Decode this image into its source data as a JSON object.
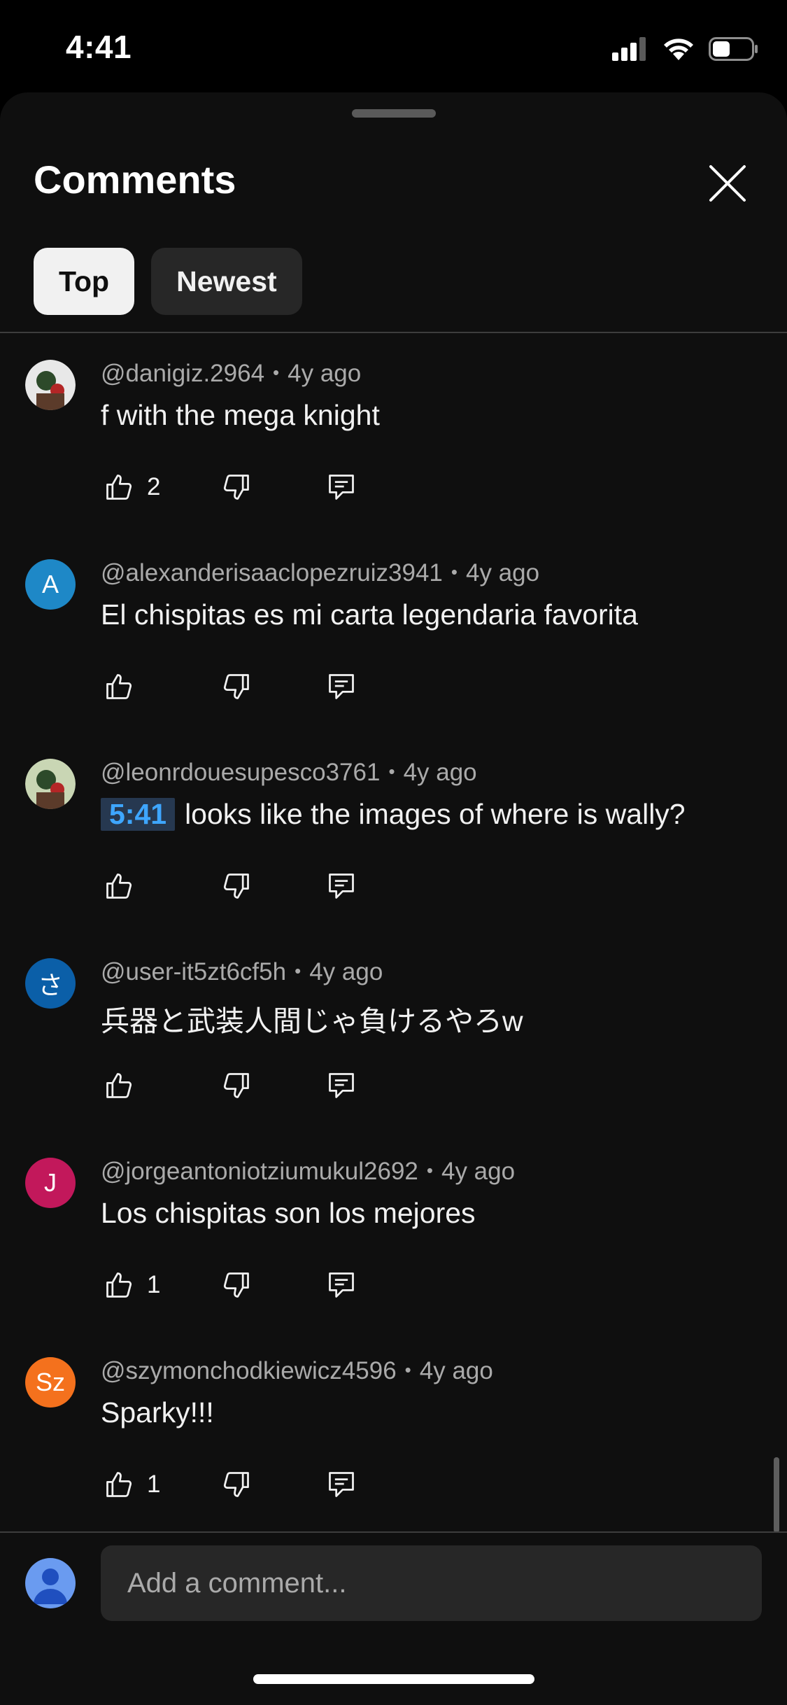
{
  "status_bar": {
    "time": "4:41",
    "icons": [
      "cellular-signal-icon",
      "wifi-icon",
      "battery-icon"
    ],
    "battery_level": 0.45
  },
  "sheet": {
    "title": "Comments",
    "close_icon": "close-icon",
    "filters": [
      {
        "label": "Top",
        "selected": true
      },
      {
        "label": "Newest",
        "selected": false
      }
    ]
  },
  "comments": [
    {
      "author": "@danigiz.2964",
      "age": "4y ago",
      "text": "f with the mega knight",
      "likes": "2",
      "avatar": {
        "kind": "image",
        "letter": "",
        "color": "#e8e8e8"
      }
    },
    {
      "author": "@alexanderisaaclopezruiz3941",
      "age": "4y ago",
      "text": "El chispitas es mi carta legendaria favorita",
      "likes": "",
      "avatar": {
        "kind": "letter",
        "letter": "A",
        "color": "#1e88c7"
      }
    },
    {
      "author": "@leonrdouesupesco3761",
      "age": "4y ago",
      "timestamp": "5:41",
      "text": "looks like the images of where is wally?",
      "likes": "",
      "avatar": {
        "kind": "image",
        "letter": "",
        "color": "#c9d6b4"
      }
    },
    {
      "author": "@user-it5zt6cf5h",
      "age": "4y ago",
      "text": "兵器と武装人間じゃ負けるやろw",
      "likes": "",
      "avatar": {
        "kind": "letter",
        "letter": "さ",
        "color": "#0b5fa8"
      }
    },
    {
      "author": "@jorgeantoniotziumukul2692",
      "age": "4y ago",
      "text": "Los chispitas son los mejores",
      "likes": "1",
      "avatar": {
        "kind": "letter",
        "letter": "J",
        "color": "#c2185b"
      }
    },
    {
      "author": "@szymonchodkiewicz4596",
      "age": "4y ago",
      "text": "Sparky!!!",
      "likes": "1",
      "avatar": {
        "kind": "letter",
        "letter": "Sz",
        "color": "#f4711d"
      }
    }
  ],
  "action_icons": [
    "like-icon",
    "dislike-icon",
    "reply-icon"
  ],
  "composer": {
    "placeholder": "Add a comment...",
    "value": "",
    "avatar_color": "#6a9bf0"
  }
}
